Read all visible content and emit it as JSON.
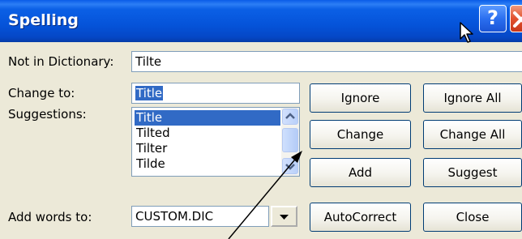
{
  "dialog": {
    "title": "Spelling",
    "help_label": "?"
  },
  "not_in_dictionary": {
    "label": "Not in Dictionary:",
    "value": "Tilte"
  },
  "change_to": {
    "label": "Change to:",
    "value": "Title"
  },
  "suggestions": {
    "label": "Suggestions:",
    "items": [
      "Title",
      "Tilted",
      "Tilter",
      "Tilde"
    ],
    "selected_index": 0
  },
  "add_words_to": {
    "label": "Add words to:",
    "value": "CUSTOM.DIC"
  },
  "buttons": {
    "ignore": "Ignore",
    "ignore_all": "Ignore All",
    "change": "Change",
    "change_all": "Change All",
    "add": "Add",
    "suggest": "Suggest",
    "autocorrect": "AutoCorrect",
    "close": "Close"
  },
  "icons": {
    "help": "help-icon",
    "close": "close-icon",
    "cursor": "mouse-pointer-icon",
    "arrow": "annotation-arrow-icon"
  },
  "colors": {
    "titlebar": "#0553d9",
    "dialog_bg": "#ece9d8",
    "selection": "#316ac5",
    "close_btn": "#e2512e"
  }
}
